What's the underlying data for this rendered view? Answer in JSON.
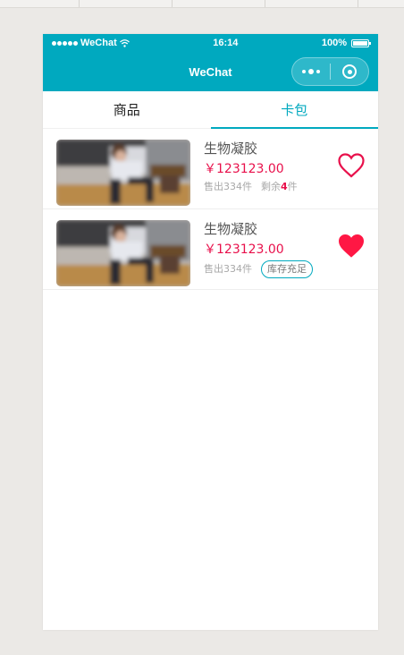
{
  "status_bar": {
    "carrier": "WeChat",
    "time": "16:14",
    "battery": "100%"
  },
  "navbar": {
    "title": "WeChat"
  },
  "tabs": [
    {
      "label": "商品",
      "active": false
    },
    {
      "label": "卡包",
      "active": true
    }
  ],
  "products": [
    {
      "title": "生物凝胶",
      "price": "￥123123.00",
      "sold": "售出334件",
      "remaining_prefix": "剩余",
      "remaining_count": "4",
      "remaining_suffix": "件",
      "favorited": false
    },
    {
      "title": "生物凝胶",
      "price": "￥123123.00",
      "sold": "售出334件",
      "stock_tag": "库存充足",
      "favorited": true
    }
  ],
  "colors": {
    "accent": "#00a9bf",
    "price": "#e8104b",
    "heart": "#ff1744"
  }
}
